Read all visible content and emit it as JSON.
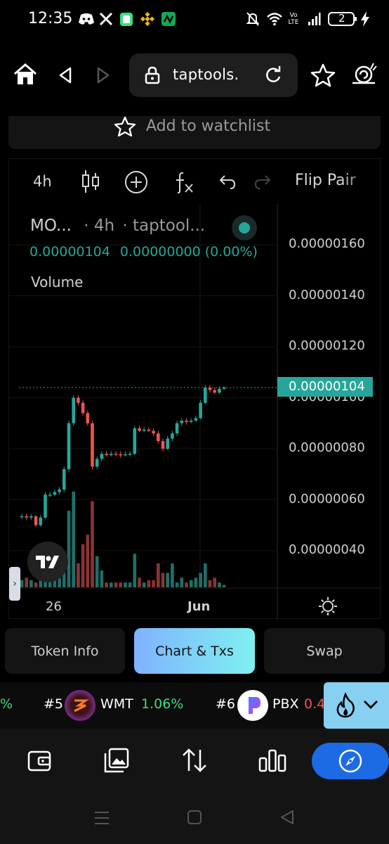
{
  "status_bar": {
    "time": "12:35",
    "battery": "2",
    "network": "Vo LTE"
  },
  "browser": {
    "url": "taptools."
  },
  "watchlist": {
    "label": "Add to watchlist"
  },
  "chart_toolbar": {
    "timeframe": "4h",
    "flip_label": "Flip Pair"
  },
  "legend": {
    "symbol": "MO...",
    "interval": "· 4h",
    "source": "· taptool...",
    "price": "0.00000104",
    "change": "0.00000000 (0.00%)",
    "volume_label": "Volume"
  },
  "chart_data": {
    "type": "candlestick",
    "y_axis_labels": [
      "0.00000160",
      "0.00000140",
      "0.00000120",
      "0.00000100",
      "0.00000080",
      "0.00000060",
      "0.00000040"
    ],
    "y_ticks": [
      1.6,
      1.4,
      1.2,
      1.0,
      0.8,
      0.6,
      0.4
    ],
    "y_unit_scale": "1e-6",
    "current_price_label": "0.00000104",
    "current_price": 1.04,
    "x_axis_labels": [
      "26",
      "Jun"
    ],
    "up_color": "#26a69a",
    "down_color": "#ef5350",
    "candles": [
      [
        0.535,
        0.535,
        0.545,
        0.525
      ],
      [
        0.535,
        0.53,
        0.545,
        0.52
      ],
      [
        0.53,
        0.535,
        0.545,
        0.52
      ],
      [
        0.535,
        0.5,
        0.54,
        0.495
      ],
      [
        0.5,
        0.53,
        0.54,
        0.495
      ],
      [
        0.53,
        0.62,
        0.63,
        0.525
      ],
      [
        0.62,
        0.62,
        0.63,
        0.61
      ],
      [
        0.62,
        0.63,
        0.64,
        0.615
      ],
      [
        0.63,
        0.64,
        0.65,
        0.62
      ],
      [
        0.64,
        0.72,
        0.73,
        0.63
      ],
      [
        0.72,
        0.9,
        0.91,
        0.71
      ],
      [
        0.9,
        1.0,
        1.01,
        0.89
      ],
      [
        1.0,
        0.98,
        1.01,
        0.97
      ],
      [
        0.98,
        0.94,
        0.99,
        0.93
      ],
      [
        0.94,
        0.9,
        0.95,
        0.89
      ],
      [
        0.9,
        0.73,
        0.91,
        0.72
      ],
      [
        0.73,
        0.76,
        0.77,
        0.72
      ],
      [
        0.76,
        0.78,
        0.79,
        0.75
      ],
      [
        0.78,
        0.775,
        0.79,
        0.77
      ],
      [
        0.775,
        0.78,
        0.79,
        0.77
      ],
      [
        0.78,
        0.778,
        0.79,
        0.77
      ],
      [
        0.778,
        0.775,
        0.79,
        0.765
      ],
      [
        0.775,
        0.778,
        0.79,
        0.77
      ],
      [
        0.778,
        0.78,
        0.79,
        0.77
      ],
      [
        0.78,
        0.88,
        0.89,
        0.775
      ],
      [
        0.88,
        0.87,
        0.89,
        0.865
      ],
      [
        0.87,
        0.875,
        0.885,
        0.865
      ],
      [
        0.875,
        0.87,
        0.885,
        0.865
      ],
      [
        0.87,
        0.86,
        0.88,
        0.85
      ],
      [
        0.86,
        0.83,
        0.87,
        0.82
      ],
      [
        0.83,
        0.8,
        0.84,
        0.79
      ],
      [
        0.8,
        0.84,
        0.85,
        0.795
      ],
      [
        0.84,
        0.86,
        0.87,
        0.83
      ],
      [
        0.86,
        0.9,
        0.91,
        0.85
      ],
      [
        0.9,
        0.91,
        0.92,
        0.89
      ],
      [
        0.91,
        0.905,
        0.92,
        0.895
      ],
      [
        0.905,
        0.91,
        0.92,
        0.9
      ],
      [
        0.91,
        0.92,
        0.93,
        0.905
      ],
      [
        0.92,
        0.98,
        0.99,
        0.915
      ],
      [
        0.98,
        1.04,
        1.05,
        0.975
      ],
      [
        1.04,
        1.03,
        1.05,
        1.02
      ],
      [
        1.03,
        1.02,
        1.04,
        1.015
      ],
      [
        1.02,
        1.035,
        1.045,
        1.015
      ],
      [
        1.035,
        1.04,
        1.045,
        1.03
      ]
    ],
    "volumes": [
      3,
      4,
      3,
      2,
      4,
      10,
      3,
      6,
      4,
      8,
      32,
      40,
      10,
      18,
      22,
      36,
      13,
      7,
      2,
      2,
      2,
      2,
      2,
      2,
      14,
      4,
      2,
      3,
      3,
      10,
      6,
      6,
      10,
      2,
      4,
      2,
      3,
      4,
      6,
      10,
      3,
      4,
      2,
      1
    ]
  },
  "tabs": [
    {
      "label": "Token Info"
    },
    {
      "label": "Chart & Txs"
    },
    {
      "label": "Swap"
    }
  ],
  "ticker": {
    "prefix": "%",
    "items": [
      {
        "rank": "#5",
        "symbol": "WMT",
        "change": "1.06%"
      },
      {
        "rank": "#6",
        "symbol": "PBX",
        "change": "0.4"
      }
    ]
  },
  "colors": {
    "accent_teal": "#26a69a",
    "accent_red": "#ef5350",
    "nav_active": "#1d6ae5"
  }
}
